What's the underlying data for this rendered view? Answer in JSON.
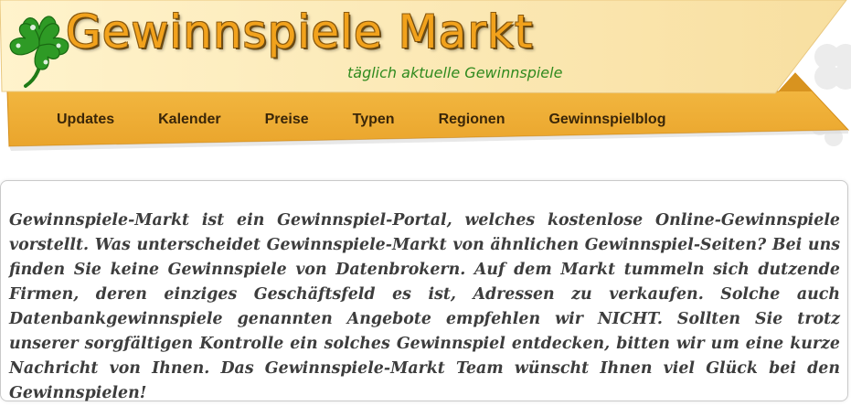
{
  "header": {
    "title": "Gewinnspiele Markt",
    "tagline": "täglich aktuelle Gewinnspiele"
  },
  "nav": {
    "items": [
      {
        "label": "Updates"
      },
      {
        "label": "Kalender"
      },
      {
        "label": "Preise"
      },
      {
        "label": "Typen"
      },
      {
        "label": "Regionen"
      },
      {
        "label": "Gewinnspielblog"
      }
    ]
  },
  "content": {
    "intro_text": "Gewinnspiele-Markt ist ein Gewinnspiel-Portal, welches kostenlose Online-Gewinnspiele vorstellt. Was unterscheidet Gewinnspiele-Markt von ähnlichen Gewinnspiel-Seiten? Bei uns finden Sie keine Gewinnspiele von Datenbrokern. Auf dem Markt tummeln sich dutzende Firmen, deren einziges Geschäftsfeld es ist, Adressen zu verkaufen. Solche auch Datenbankgewinnspiele genannten Angebote empfehlen wir NICHT. Sollten Sie trotz unserer sorgfältigen Kontrolle ein solches Gewinnspiel entdecken, bitten wir um eine kurze Nachricht von Ihnen. Das Gewinnspiele-Markt Team wünscht Ihnen viel Glück bei den Gewinnspielen!"
  },
  "colors": {
    "banner_light": "#fbe9b3",
    "banner_orange": "#f2b13a",
    "title_orange": "#f2a21c",
    "tagline_green": "#2f8a1e",
    "clover_green": "#2e9a25",
    "nav_text": "#3a2608",
    "body_text": "#3d3d3d"
  },
  "icons": [
    "four-leaf-clover-logo-icon",
    "decorative-clover-icon"
  ]
}
